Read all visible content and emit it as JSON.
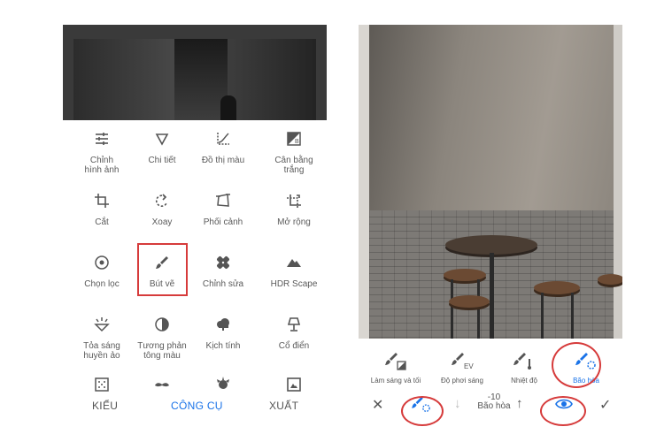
{
  "left_panel": {
    "tools": [
      {
        "label": "Chỉnh\nhình ảnh",
        "icon": "tune-icon"
      },
      {
        "label": "Chi tiết",
        "icon": "triangle-down-icon"
      },
      {
        "label": "Đồ thị màu",
        "icon": "curves-icon"
      },
      {
        "label": "Cân bằng\ntrắng",
        "icon": "white-balance-icon"
      },
      {
        "label": "Cắt",
        "icon": "crop-icon"
      },
      {
        "label": "Xoay",
        "icon": "rotate-icon"
      },
      {
        "label": "Phối cảnh",
        "icon": "perspective-icon"
      },
      {
        "label": "Mở rộng",
        "icon": "expand-icon"
      },
      {
        "label": "Chọn lọc",
        "icon": "selective-icon"
      },
      {
        "label": "Bút vẽ",
        "icon": "brush-icon"
      },
      {
        "label": "Chỉnh sửa",
        "icon": "healing-icon"
      },
      {
        "label": "HDR Scape",
        "icon": "mountain-icon"
      },
      {
        "label": "Tỏa sáng\nhuyền ảo",
        "icon": "glamour-glow-icon"
      },
      {
        "label": "Tương phản\ntông màu",
        "icon": "tonal-contrast-icon"
      },
      {
        "label": "Kịch tính",
        "icon": "drama-cloud-icon"
      },
      {
        "label": "Cổ điển",
        "icon": "vintage-lamp-icon"
      },
      {
        "label": "",
        "icon": "grain-icon"
      },
      {
        "label": "",
        "icon": "mustache-icon"
      },
      {
        "label": "",
        "icon": "grunge-icon"
      },
      {
        "label": "",
        "icon": "frame-icon"
      }
    ],
    "nav": {
      "styles": "KIỂU",
      "tools": "CÔNG CỤ",
      "export": "XUẤT"
    },
    "nav_active_color": "#1a73e8"
  },
  "right_panel": {
    "brush_tools": [
      {
        "label": "Làm sáng và tối",
        "icon": "brush-dodge-burn-icon"
      },
      {
        "label": "Độ phơi sáng",
        "icon": "brush-exposure-icon"
      },
      {
        "label": "Nhiệt độ",
        "icon": "brush-temperature-icon"
      },
      {
        "label": "Bão hòa",
        "icon": "brush-saturation-icon",
        "active": true
      }
    ],
    "bottom": {
      "value": "-10",
      "param": "Bão hòa",
      "close_glyph": "✕",
      "apply_glyph": "✓",
      "down_glyph": "↓",
      "up_glyph": "↑"
    },
    "accent_color": "#1a73e8",
    "highlight_color": "#d63b3b"
  }
}
